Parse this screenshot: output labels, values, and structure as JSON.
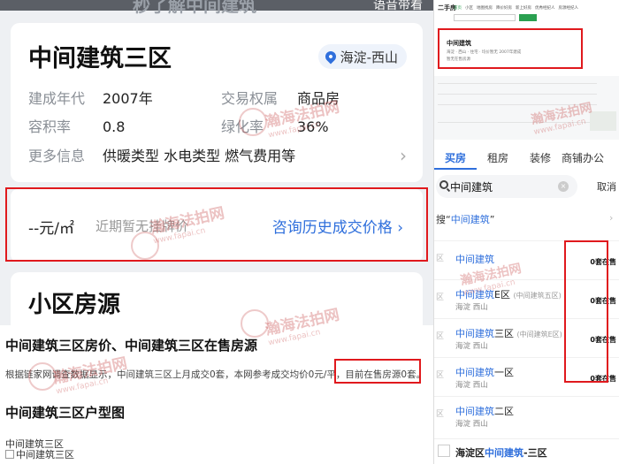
{
  "left": {
    "header_ghost": "秒了解中间建筑",
    "voice": "语音带看",
    "card1": {
      "title": "中间建筑三区",
      "location": "海淀-西山",
      "attrs": [
        {
          "k": "建成年代",
          "v": "2007年"
        },
        {
          "k": "交易权属",
          "v": "商品房"
        },
        {
          "k": "容积率",
          "v": "0.8"
        },
        {
          "k": "绿化率",
          "v": "36%"
        }
      ],
      "more_label": "更多信息",
      "more_value": "供暖类型 水电类型 燃气费用等"
    },
    "card2": {
      "price": "--元/㎡",
      "note": "近期暂无挂牌价",
      "consult": "咨询历史成交价格"
    },
    "card3": {
      "heading": "小区房源"
    },
    "sheet": {
      "h1": "中间建筑三区房价、中间建筑三区在售房源",
      "p_main": "根据链家网调查数据显示，中间建筑三区上月成交0套，本网参考成交均价0元/平，",
      "p_hl": "目前在售房源0套。",
      "h2": "中间建筑三区户型图",
      "t1": "中间建筑三区",
      "t2": "中间建筑三区"
    },
    "watermark": "瀚海法拍网",
    "watermark_url": "www.fapai.cn"
  },
  "right": {
    "top": {
      "title": "二手房",
      "tabs": [
        "首页",
        "小区",
        "地图找房",
        "降价好房",
        "新上好房",
        "优秀经纪人",
        "房源经纪人"
      ],
      "box_title": "中间建筑",
      "box_line1": "海淀 · 西山 · 住宅 · 均价暂无",
      "box_line2": "2007年建成",
      "box_line3": "暂无在售房源"
    },
    "tabs": [
      "买房",
      "租房",
      "装修",
      "商铺办公"
    ],
    "active_tab": "买房",
    "search_query": "中间建筑",
    "clear_glyph": "×",
    "cancel": "取消",
    "search_all_prefix": "搜“",
    "search_all_hl": "中间建筑",
    "search_all_suffix": "”",
    "search_all_chevron": "›",
    "items": [
      {
        "tag": "区",
        "pre": "",
        "hl": "中间建筑",
        "post": "",
        "sub": "",
        "area": "",
        "count": "0套在售"
      },
      {
        "tag": "区",
        "pre": "",
        "hl": "中间建筑",
        "post": "E区",
        "sub": "(中间建筑五区)",
        "area": "海淀 西山",
        "count": "0套在售"
      },
      {
        "tag": "区",
        "pre": "",
        "hl": "中间建筑",
        "post": "三区",
        "sub": "(中间建筑E区)",
        "area": "海淀 西山",
        "count": "0套在售"
      },
      {
        "tag": "区",
        "pre": "",
        "hl": "中间建筑",
        "post": "一区",
        "sub": "",
        "area": "海淀 西山",
        "count": "0套在售"
      },
      {
        "tag": "区",
        "pre": "",
        "hl": "中间建筑",
        "post": "二区",
        "sub": "",
        "area": "海淀 西山",
        "count": ""
      }
    ],
    "last": {
      "pre": "海淀区",
      "hl": "中间建筑",
      "post": "-三区"
    }
  },
  "colors": {
    "accent_blue": "#2f6fdc",
    "highlight_red": "#e0191d",
    "green": "#2aa050"
  }
}
